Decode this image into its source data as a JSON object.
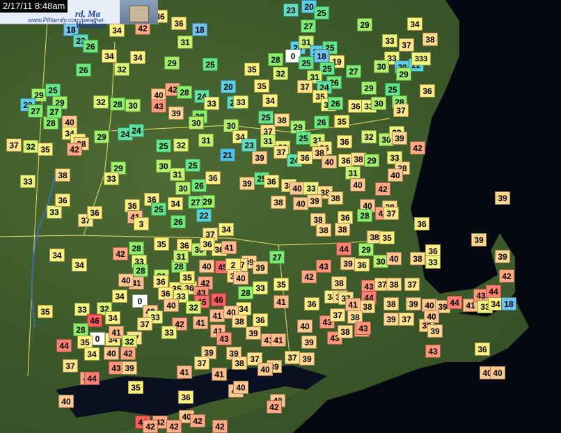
{
  "header": {
    "timestamp": "2/17/11 8:48am",
    "brand_partial": "rd, Ma",
    "brand_line2": "Weather",
    "url": "www.PIIfamily.com/weather"
  },
  "colors": {
    "18": "#6fc3ee",
    "20": "#5cd0e8",
    "21": "#4fc0e6",
    "22": "#55d6d6",
    "23": "#5fdcc0",
    "24": "#5ee0a0",
    "25": "#64e488",
    "26": "#6ee87a",
    "27": "#7aea70",
    "28": "#8aee6a",
    "29": "#9ef068",
    "30": "#b4f06a",
    "31": "#c8f26e",
    "32": "#dcf474",
    "33": "#eef47c",
    "34": "#fff27e",
    "35": "#fff07c",
    "36": "#ffec82",
    "37": "#ffe488",
    "38": "#ffdc8c",
    "39": "#ffd48e",
    "40": "#ffc890",
    "41": "#ffba8a",
    "42": "#ffa882",
    "43": "#ff9678",
    "44": "#ff8070",
    "45": "#ff6c68",
    "46": "#ff5c60",
    "0": "#ffffff"
  },
  "stations": [
    [
      "42",
      205,
      40
    ],
    [
      "36",
      230,
      23
    ],
    [
      "36",
      257,
      33
    ],
    [
      "18",
      287,
      42
    ],
    [
      "23",
      418,
      14
    ],
    [
      "20",
      444,
      8
    ],
    [
      "25",
      462,
      18
    ],
    [
      "27",
      443,
      37
    ],
    [
      "29",
      524,
      35
    ],
    [
      "34",
      596,
      34
    ],
    [
      "34",
      168,
      43
    ],
    [
      "31",
      266,
      60
    ],
    [
      "18",
      102,
      42
    ],
    [
      "23",
      116,
      58
    ],
    [
      "26",
      130,
      66
    ],
    [
      "34",
      157,
      80
    ],
    [
      "34",
      198,
      82
    ],
    [
      "29",
      247,
      90
    ],
    [
      "25",
      302,
      92
    ],
    [
      "20",
      428,
      68
    ],
    [
      "31",
      440,
      60
    ],
    [
      "0",
      421,
      80
    ],
    [
      "20",
      456,
      74
    ],
    [
      "25",
      474,
      68
    ],
    [
      "18",
      462,
      80
    ],
    [
      "25",
      440,
      90
    ],
    [
      "19",
      484,
      88
    ],
    [
      "25",
      470,
      98
    ],
    [
      "28",
      396,
      85
    ],
    [
      "32",
      403,
      105
    ],
    [
      "27",
      508,
      102
    ],
    [
      "33",
      560,
      58
    ],
    [
      "37",
      584,
      64
    ],
    [
      "38",
      618,
      56
    ],
    [
      "33",
      563,
      83
    ],
    [
      "30",
      548,
      95
    ],
    [
      "20",
      578,
      96
    ],
    [
      "22",
      598,
      93
    ],
    [
      "333",
      602,
      84
    ],
    [
      "29",
      580,
      106
    ],
    [
      "26",
      120,
      100
    ],
    [
      "32",
      175,
      99
    ],
    [
      "35",
      362,
      99
    ],
    [
      "35",
      376,
      123
    ],
    [
      "31",
      452,
      110
    ],
    [
      "37",
      438,
      124
    ],
    [
      "26",
      480,
      118
    ],
    [
      "24",
      466,
      125
    ],
    [
      "35",
      460,
      138
    ],
    [
      "33",
      472,
      150
    ],
    [
      "26",
      482,
      148
    ],
    [
      "29",
      530,
      126
    ],
    [
      "25",
      564,
      128
    ],
    [
      "36",
      614,
      130
    ],
    [
      "29",
      56,
      136
    ],
    [
      "25",
      76,
      129
    ],
    [
      "20",
      40,
      150
    ],
    [
      "29",
      86,
      147
    ],
    [
      "32",
      145,
      146
    ],
    [
      "28",
      169,
      149
    ],
    [
      "30",
      191,
      151
    ],
    [
      "40",
      228,
      136
    ],
    [
      "42",
      248,
      128
    ],
    [
      "28",
      265,
      132
    ],
    [
      "24",
      290,
      138
    ],
    [
      "20",
      328,
      124
    ],
    [
      "33",
      304,
      148
    ],
    [
      "23",
      337,
      147
    ],
    [
      "33",
      346,
      146
    ],
    [
      "34",
      388,
      144
    ],
    [
      "36",
      511,
      152
    ],
    [
      "33",
      530,
      152
    ],
    [
      "30",
      544,
      148
    ],
    [
      "28",
      574,
      146
    ],
    [
      "37",
      576,
      158
    ],
    [
      "43",
      228,
      152
    ],
    [
      "39",
      253,
      162
    ],
    [
      "28",
      287,
      167
    ],
    [
      "30",
      282,
      176
    ],
    [
      "30",
      332,
      180
    ],
    [
      "34",
      345,
      196
    ],
    [
      "25",
      382,
      168
    ],
    [
      "37",
      385,
      188
    ],
    [
      "38",
      405,
      172
    ],
    [
      "29",
      428,
      182
    ],
    [
      "26",
      462,
      175
    ],
    [
      "35",
      491,
      174
    ],
    [
      "27",
      51,
      159
    ],
    [
      "28",
      73,
      176
    ],
    [
      "27",
      78,
      160
    ],
    [
      "40",
      100,
      175
    ],
    [
      "37",
      20,
      208
    ],
    [
      "32",
      44,
      210
    ],
    [
      "35",
      65,
      214
    ],
    [
      "34",
      100,
      191
    ],
    [
      "34",
      112,
      201
    ],
    [
      "38",
      117,
      206
    ],
    [
      "42",
      107,
      214
    ],
    [
      "29",
      146,
      196
    ],
    [
      "24",
      180,
      192
    ],
    [
      "24",
      196,
      187
    ],
    [
      "25",
      235,
      209
    ],
    [
      "32",
      260,
      208
    ],
    [
      "31",
      296,
      201
    ],
    [
      "23",
      358,
      208
    ],
    [
      "31",
      385,
      202
    ],
    [
      "33",
      406,
      211
    ],
    [
      "25",
      436,
      198
    ],
    [
      "31",
      456,
      201
    ],
    [
      "36",
      466,
      212
    ],
    [
      "36",
      495,
      203
    ],
    [
      "32",
      530,
      196
    ],
    [
      "30",
      555,
      200
    ],
    [
      "33",
      570,
      190
    ],
    [
      "39",
      574,
      198
    ],
    [
      "42",
      600,
      212
    ],
    [
      "29",
      170,
      241
    ],
    [
      "30",
      235,
      238
    ],
    [
      "31",
      255,
      250
    ],
    [
      "25",
      277,
      237
    ],
    [
      "21",
      327,
      222
    ],
    [
      "39",
      373,
      226
    ],
    [
      "37",
      404,
      218
    ],
    [
      "24",
      423,
      230
    ],
    [
      "36",
      438,
      226
    ],
    [
      "38",
      459,
      219
    ],
    [
      "40",
      473,
      232
    ],
    [
      "36",
      497,
      230
    ],
    [
      "38",
      515,
      228
    ],
    [
      "29",
      534,
      230
    ],
    [
      "33",
      567,
      226
    ],
    [
      "38",
      578,
      241
    ],
    [
      "33",
      40,
      260
    ],
    [
      "38",
      90,
      251
    ],
    [
      "33",
      160,
      256
    ],
    [
      "30",
      263,
      270
    ],
    [
      "26",
      286,
      266
    ],
    [
      "36",
      306,
      255
    ],
    [
      "39",
      355,
      263
    ],
    [
      "25",
      376,
      256
    ],
    [
      "36",
      390,
      260
    ],
    [
      "36",
      415,
      266
    ],
    [
      "40",
      427,
      270
    ],
    [
      "33",
      447,
      270
    ],
    [
      "38",
      467,
      276
    ],
    [
      "31",
      507,
      248
    ],
    [
      "40",
      514,
      265
    ],
    [
      "42",
      550,
      271
    ],
    [
      "40",
      568,
      251
    ],
    [
      "33",
      78,
      304
    ],
    [
      "36",
      90,
      287
    ],
    [
      "37",
      123,
      316
    ],
    [
      "36",
      136,
      305
    ],
    [
      "36",
      190,
      295
    ],
    [
      "36",
      218,
      286
    ],
    [
      "25",
      228,
      300
    ],
    [
      "34",
      252,
      292
    ],
    [
      "41",
      194,
      311
    ],
    [
      "3",
      203,
      321
    ],
    [
      "26",
      256,
      318
    ],
    [
      "22",
      293,
      309
    ],
    [
      "29",
      298,
      289
    ],
    [
      "27",
      281,
      290
    ],
    [
      "38",
      400,
      290
    ],
    [
      "40",
      432,
      292
    ],
    [
      "39",
      452,
      288
    ],
    [
      "38",
      482,
      284
    ],
    [
      "40",
      528,
      295
    ],
    [
      "38",
      560,
      297
    ],
    [
      "42",
      550,
      306
    ],
    [
      "37",
      562,
      306
    ],
    [
      "28",
      524,
      309
    ],
    [
      "38",
      457,
      315
    ],
    [
      "36",
      496,
      312
    ],
    [
      "36",
      606,
      321
    ],
    [
      "39",
      722,
      284
    ],
    [
      "34",
      325,
      329
    ],
    [
      "37",
      302,
      336
    ],
    [
      "38",
      465,
      330
    ],
    [
      "38",
      492,
      329
    ],
    [
      "28",
      196,
      356
    ],
    [
      "35",
      232,
      350
    ],
    [
      "42",
      173,
      364
    ],
    [
      "33",
      200,
      375
    ],
    [
      "36",
      265,
      352
    ],
    [
      "30",
      286,
      358
    ],
    [
      "36",
      315,
      358
    ],
    [
      "36",
      298,
      350
    ],
    [
      "41",
      329,
      355
    ],
    [
      "39",
      358,
      376
    ],
    [
      "37",
      345,
      380
    ],
    [
      "28",
      257,
      382
    ],
    [
      "31",
      260,
      368
    ],
    [
      "40",
      297,
      382
    ],
    [
      "45",
      320,
      383
    ],
    [
      "2",
      335,
      380
    ],
    [
      "27",
      398,
      369
    ],
    [
      "43",
      465,
      382
    ],
    [
      "44",
      494,
      357
    ],
    [
      "39",
      500,
      378
    ],
    [
      "36",
      520,
      380
    ],
    [
      "29",
      526,
      358
    ],
    [
      "38",
      538,
      340
    ],
    [
      "35",
      556,
      341
    ],
    [
      "30",
      547,
      375
    ],
    [
      "40",
      566,
      371
    ],
    [
      "36",
      622,
      360
    ],
    [
      "33",
      622,
      376
    ],
    [
      "39",
      688,
      344
    ],
    [
      "38",
      600,
      371
    ],
    [
      "34",
      82,
      366
    ],
    [
      "34",
      114,
      380
    ],
    [
      "28",
      202,
      388
    ],
    [
      "31",
      232,
      396
    ],
    [
      "36",
      231,
      404
    ],
    [
      "41",
      196,
      406
    ],
    [
      "40",
      181,
      402
    ],
    [
      "35",
      254,
      414
    ],
    [
      "36",
      272,
      413
    ],
    [
      "42",
      295,
      406
    ],
    [
      "33",
      260,
      425
    ],
    [
      "35",
      269,
      398
    ],
    [
      "37",
      337,
      396
    ],
    [
      "40",
      346,
      399
    ],
    [
      "33",
      374,
      413
    ],
    [
      "39",
      374,
      384
    ],
    [
      "35",
      404,
      408
    ],
    [
      "42",
      444,
      397
    ],
    [
      "34",
      172,
      425
    ],
    [
      "0",
      201,
      432
    ],
    [
      "43",
      289,
      420
    ],
    [
      "46",
      314,
      430
    ],
    [
      "45",
      290,
      433
    ],
    [
      "36",
      238,
      421
    ],
    [
      "32",
      278,
      441
    ],
    [
      "40",
      246,
      438
    ],
    [
      "28",
      353,
      420
    ],
    [
      "34",
      350,
      443
    ],
    [
      "41",
      404,
      433
    ],
    [
      "38",
      487,
      406
    ],
    [
      "43",
      530,
      411
    ],
    [
      "37",
      549,
      408
    ],
    [
      "38",
      566,
      408
    ],
    [
      "37",
      592,
      408
    ],
    [
      "42",
      728,
      396
    ],
    [
      "39",
      722,
      368
    ],
    [
      "44",
      530,
      427
    ],
    [
      "34",
      477,
      426
    ],
    [
      "38",
      489,
      426
    ],
    [
      "37",
      497,
      428
    ],
    [
      "41",
      507,
      437
    ],
    [
      "38",
      528,
      440
    ],
    [
      "38",
      562,
      436
    ],
    [
      "39",
      594,
      436
    ],
    [
      "40",
      617,
      438
    ],
    [
      "39",
      636,
      440
    ],
    [
      "44",
      653,
      434
    ],
    [
      "41",
      676,
      438
    ],
    [
      "43",
      691,
      424
    ],
    [
      "44",
      709,
      418
    ],
    [
      "33",
      697,
      440
    ],
    [
      "34",
      712,
      436
    ],
    [
      "18",
      731,
      436
    ],
    [
      "33",
      118,
      444
    ],
    [
      "32",
      150,
      443
    ],
    [
      "36",
      448,
      436
    ],
    [
      "35",
      65,
      447
    ],
    [
      "46",
      136,
      460
    ],
    [
      "34",
      162,
      456
    ],
    [
      "40",
      216,
      447
    ],
    [
      "33",
      223,
      455
    ],
    [
      "42",
      258,
      465
    ],
    [
      "37",
      208,
      465
    ],
    [
      "41",
      288,
      463
    ],
    [
      "41",
      312,
      453
    ],
    [
      "40",
      332,
      448
    ],
    [
      "41",
      313,
      475
    ],
    [
      "38",
      344,
      461
    ],
    [
      "36",
      374,
      459
    ],
    [
      "43",
      470,
      462
    ],
    [
      "37",
      485,
      452
    ],
    [
      "38",
      510,
      455
    ],
    [
      "39",
      562,
      458
    ],
    [
      "37",
      584,
      458
    ],
    [
      "39",
      613,
      467
    ],
    [
      "40",
      620,
      454
    ],
    [
      "39",
      625,
      475
    ],
    [
      "28",
      116,
      473
    ],
    [
      "0",
      140,
      486
    ],
    [
      "35",
      122,
      491
    ],
    [
      "34",
      162,
      487
    ],
    [
      "37",
      193,
      485
    ],
    [
      "44",
      92,
      496
    ],
    [
      "41",
      167,
      477
    ],
    [
      "40",
      438,
      468
    ],
    [
      "39",
      364,
      478
    ],
    [
      "39",
      444,
      491
    ],
    [
      "43",
      481,
      485
    ],
    [
      "42",
      520,
      474
    ],
    [
      "38",
      496,
      476
    ],
    [
      "43",
      522,
      471
    ],
    [
      "32",
      186,
      490
    ],
    [
      "33",
      243,
      477
    ],
    [
      "41",
      386,
      488
    ],
    [
      "41",
      400,
      488
    ],
    [
      "39",
      300,
      506
    ],
    [
      "43",
      322,
      486
    ],
    [
      "39",
      336,
      507
    ],
    [
      "37",
      366,
      515
    ],
    [
      "38",
      344,
      521
    ],
    [
      "39",
      394,
      526
    ],
    [
      "40",
      381,
      530
    ],
    [
      "37",
      420,
      513
    ],
    [
      "39",
      441,
      515
    ],
    [
      "34",
      132,
      508
    ],
    [
      "42",
      184,
      507
    ],
    [
      "40",
      160,
      507
    ],
    [
      "37",
      101,
      525
    ],
    [
      "43",
      167,
      528
    ],
    [
      "39",
      186,
      528
    ],
    [
      "42",
      126,
      543
    ],
    [
      "37",
      290,
      521
    ],
    [
      "41",
      265,
      534
    ],
    [
      "44",
      132,
      543
    ],
    [
      "43",
      622,
      504
    ],
    [
      "36",
      693,
      501
    ],
    [
      "40",
      700,
      535
    ],
    [
      "40",
      715,
      535
    ],
    [
      "35",
      195,
      556
    ],
    [
      "41",
      315,
      537
    ],
    [
      "36",
      267,
      570
    ],
    [
      "40",
      339,
      561
    ],
    [
      "40",
      346,
      556
    ],
    [
      "40",
      399,
      575
    ],
    [
      "42",
      394,
      584
    ],
    [
      "40",
      95,
      576
    ],
    [
      "46",
      205,
      606
    ],
    [
      "42",
      230,
      606
    ],
    [
      "40",
      268,
      598
    ],
    [
      "42",
      284,
      604
    ],
    [
      "42",
      316,
      615
    ],
    [
      "42",
      216,
      618
    ],
    [
      "42",
      250,
      618
    ]
  ]
}
